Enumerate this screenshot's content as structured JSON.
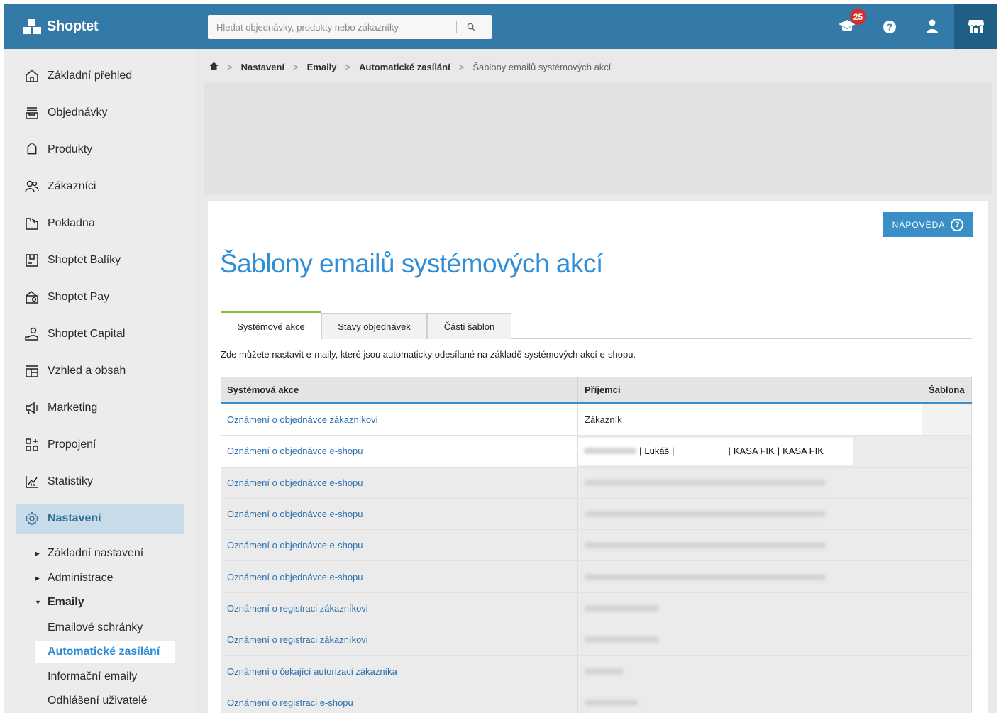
{
  "app": {
    "logo_text": "Shoptet",
    "search_placeholder": "Hledat objednávky, produkty nebo zákazníky",
    "notification_count": "25"
  },
  "sidebar": {
    "items": [
      {
        "label": "Základní přehled",
        "icon": "home-icon"
      },
      {
        "label": "Objednávky",
        "icon": "orders-icon"
      },
      {
        "label": "Produkty",
        "icon": "tag-icon"
      },
      {
        "label": "Zákazníci",
        "icon": "customers-icon"
      },
      {
        "label": "Pokladna",
        "icon": "cash-register-icon"
      },
      {
        "label": "Shoptet Balíky",
        "icon": "package-icon"
      },
      {
        "label": "Shoptet Pay",
        "icon": "wallet-icon"
      },
      {
        "label": "Shoptet Capital",
        "icon": "capital-icon"
      },
      {
        "label": "Vzhled a obsah",
        "icon": "layout-icon"
      },
      {
        "label": "Marketing",
        "icon": "megaphone-icon"
      },
      {
        "label": "Propojení",
        "icon": "connect-icon"
      },
      {
        "label": "Statistiky",
        "icon": "chart-icon"
      },
      {
        "label": "Nastavení",
        "icon": "gear-icon"
      }
    ],
    "sub_items": [
      {
        "label": "Základní nastavení"
      },
      {
        "label": "Administrace"
      },
      {
        "label": "Emaily"
      }
    ],
    "email_items": [
      {
        "label": "Emailové schránky"
      },
      {
        "label": "Automatické zasílání"
      },
      {
        "label": "Informační emaily"
      },
      {
        "label": "Odhlášení uživatelé"
      }
    ]
  },
  "breadcrumb": {
    "items": [
      "Nastavení",
      "Emaily",
      "Automatické zasílání"
    ],
    "current": "Šablony emailů systémových akcí"
  },
  "main": {
    "help_label": "NÁPOVĚDA",
    "title": "Šablony emailů systémových akcí",
    "tabs": [
      {
        "label": "Systémové akce"
      },
      {
        "label": "Stavy objednávek"
      },
      {
        "label": "Části šablon"
      }
    ],
    "description": "Zde můžete nastavit e-maily, které jsou automaticky odesílané na základě systémových akcí e-shopu.",
    "table": {
      "headers": [
        "Systémová akce",
        "Příjemci",
        "Šablona"
      ],
      "rows": [
        {
          "action": "Oznámení o objednávce zákazníkovi",
          "recipients": "Zákazník"
        },
        {
          "action": "Oznámení o objednávce e-shopu",
          "recipient_name": "Lukáš",
          "recipient_a": "KASA FIK",
          "recipient_b": "KASA FIK"
        },
        {
          "action": "Oznámení o objednávce e-shopu"
        },
        {
          "action": "Oznámení o objednávce e-shopu"
        },
        {
          "action": "Oznámení o objednávce e-shopu"
        },
        {
          "action": "Oznámení o objednávce e-shopu"
        },
        {
          "action": "Oznámení o registraci zákazníkovi"
        },
        {
          "action": "Oznámení o registraci zákazníkovi"
        },
        {
          "action": "Oznámení o čekající autorizaci zákazníka"
        },
        {
          "action": "Oznámení o registraci e-shopu"
        }
      ]
    }
  }
}
